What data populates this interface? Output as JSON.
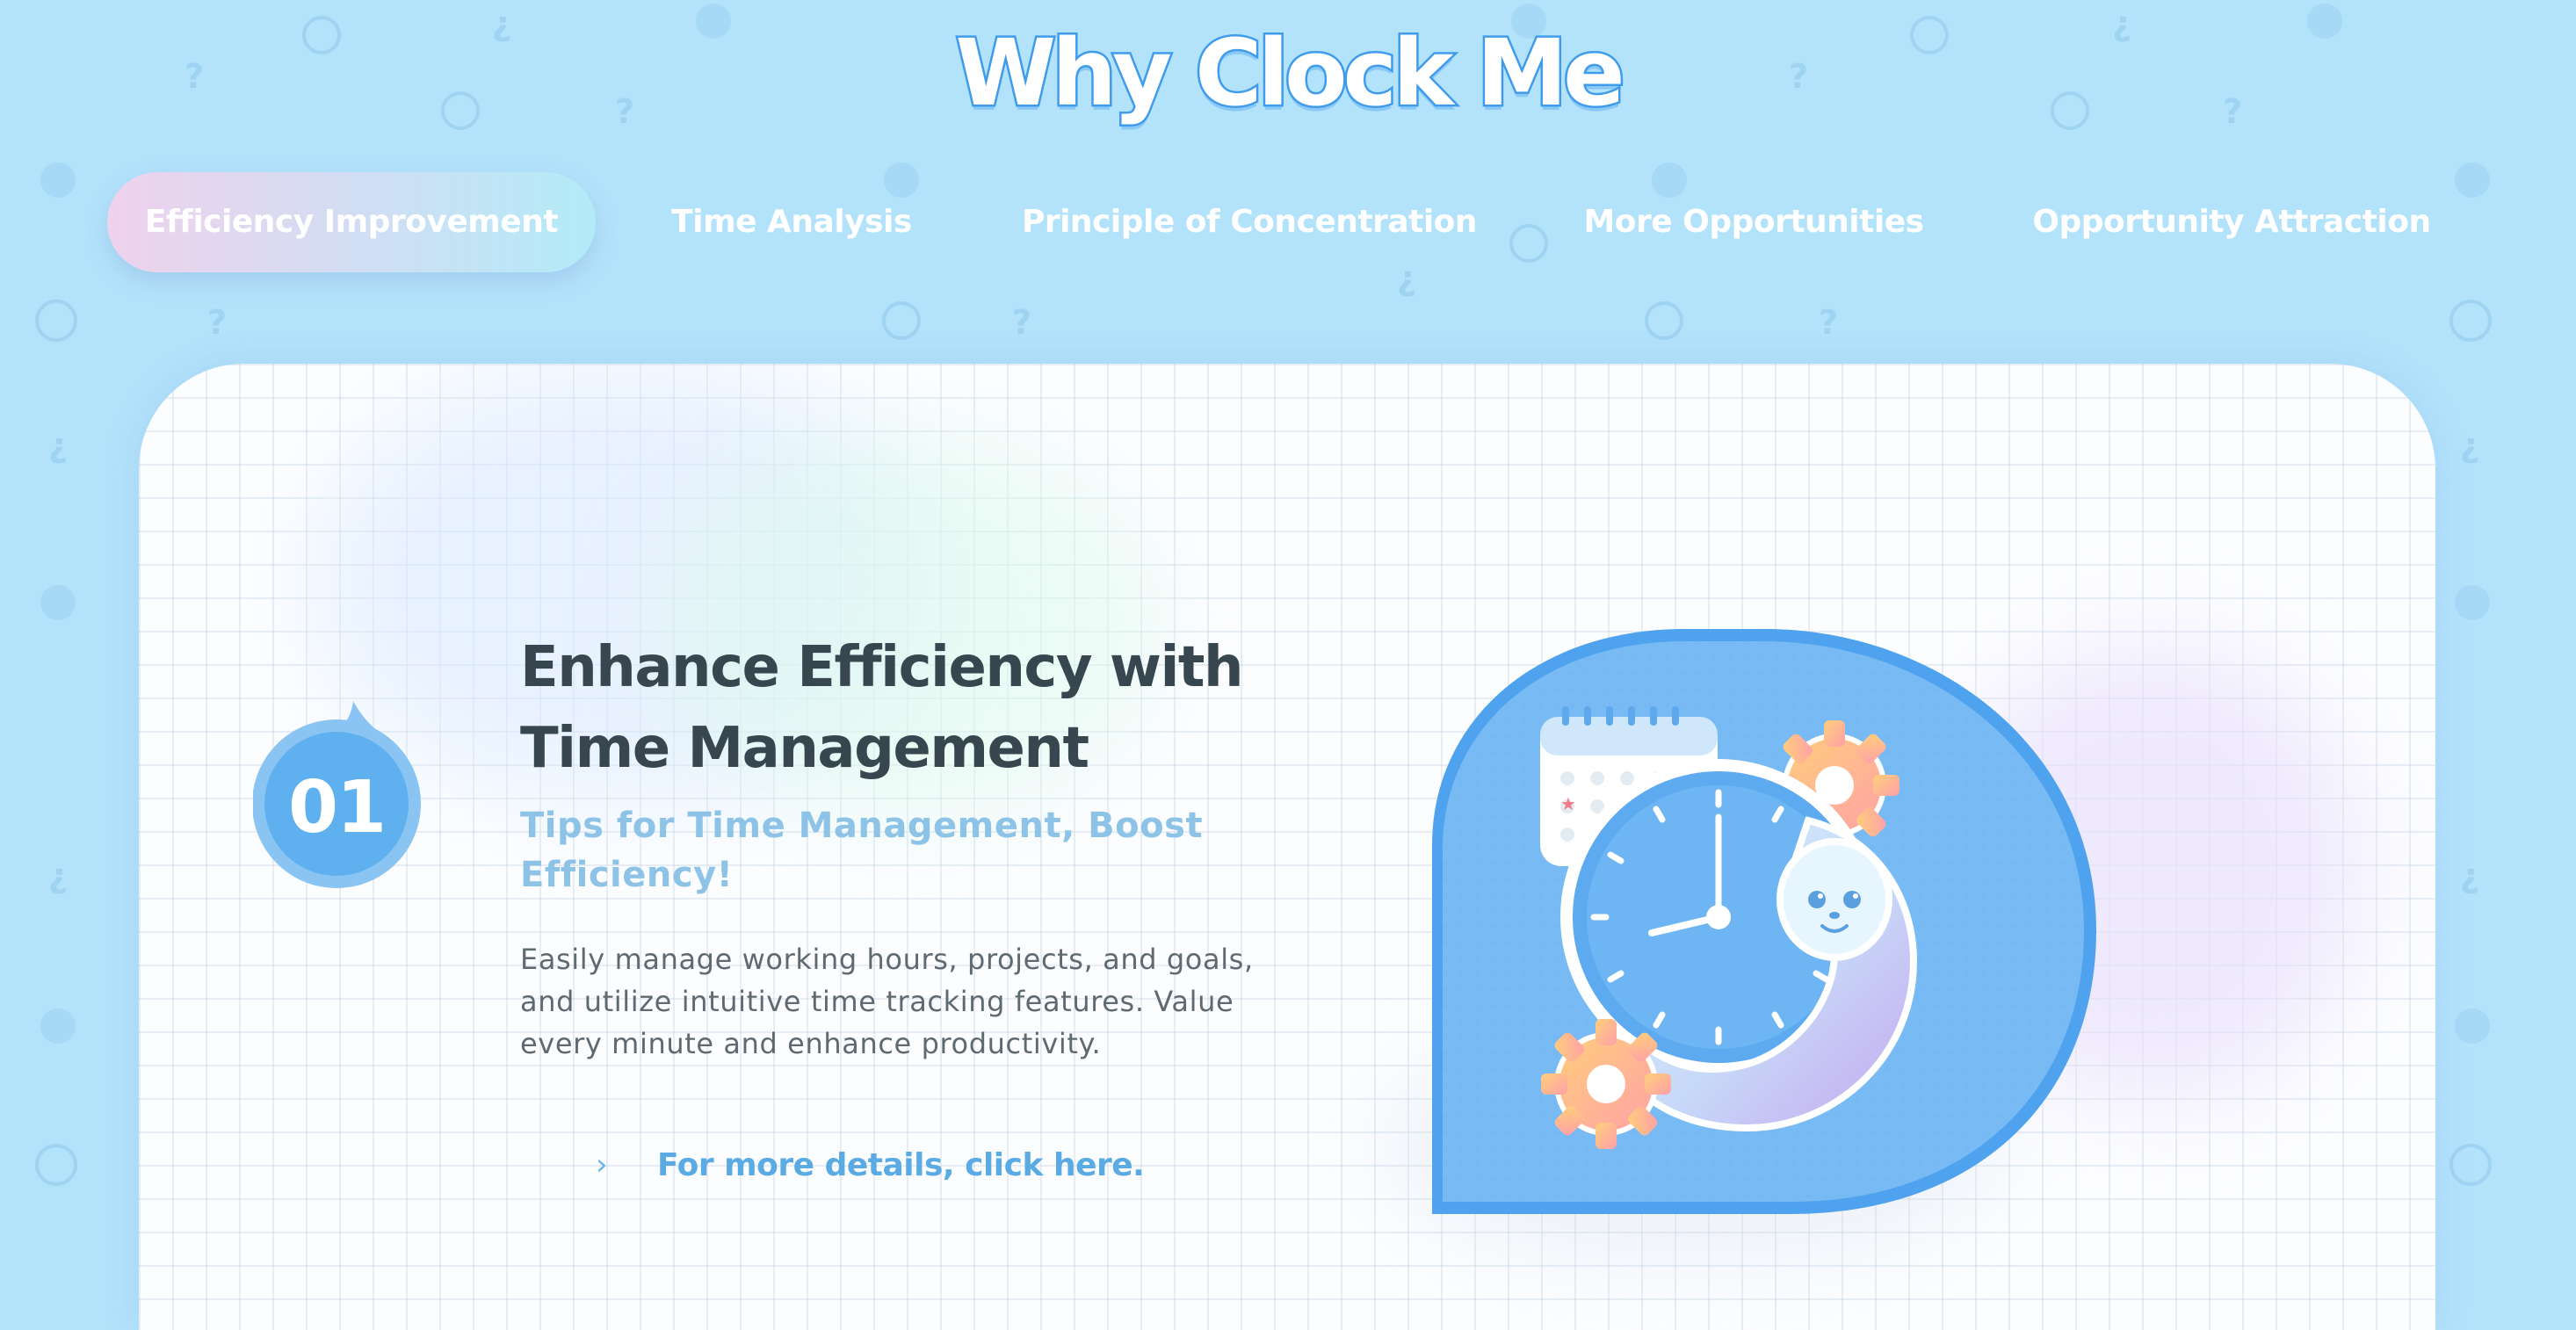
{
  "header": {
    "title": "Why Clock Me"
  },
  "tabs": [
    {
      "label": "Efficiency Improvement",
      "active": true
    },
    {
      "label": "Time Analysis",
      "active": false
    },
    {
      "label": "Principle of Concentration",
      "active": false
    },
    {
      "label": "More Opportunities",
      "active": false
    },
    {
      "label": "Opportunity Attraction",
      "active": false
    }
  ],
  "feature": {
    "number": "01",
    "heading_line1": "Enhance Efficiency with",
    "heading_line2": "Time Management",
    "subheading": "Tips for Time Management, Boost Efficiency!",
    "description": "Easily manage working hours, projects, and goals, and utilize intuitive time tracking features. Value every minute and enhance productivity.",
    "details_link": "For more details, click here.",
    "illustration": "clock-with-seal-calendar-gears"
  },
  "colors": {
    "background": "#b3e2fb",
    "title_outline": "#3f9bec",
    "heading": "#37464f",
    "subheading": "#8cc3e6",
    "link": "#5aaae3",
    "badge": "#5fb0ef"
  }
}
